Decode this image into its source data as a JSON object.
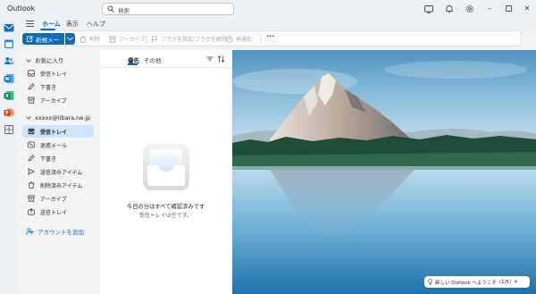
{
  "app": {
    "title": "Outlook"
  },
  "search": {
    "placeholder": "検索"
  },
  "ribbon": {
    "tabs": [
      {
        "label": "ホーム",
        "active": true
      },
      {
        "label": "表示",
        "active": false
      },
      {
        "label": "ヘルプ",
        "active": false
      }
    ],
    "new_mail_label": "新規メール",
    "buttons": {
      "delete": "削除",
      "archive": "アーカイブ",
      "flag": "フラグを設定/フラグを解除",
      "snooze": "再通知",
      "more": "···"
    }
  },
  "folders": {
    "favorites_header": "お気に入り",
    "favorites": [
      {
        "label": "受信トレイ",
        "icon": "inbox-icon"
      },
      {
        "label": "下書き",
        "icon": "draft-icon"
      },
      {
        "label": "アーカイブ",
        "icon": "archive-icon"
      }
    ],
    "account_header": "xxxxx@libara.ne.jp",
    "account_folders": [
      {
        "label": "受信トレイ",
        "icon": "inbox-icon",
        "selected": true
      },
      {
        "label": "迷惑メール",
        "icon": "junk-icon"
      },
      {
        "label": "下書き",
        "icon": "draft-icon"
      },
      {
        "label": "送信済みアイテム",
        "icon": "sent-icon"
      },
      {
        "label": "削除済みアイテム",
        "icon": "trash-icon"
      },
      {
        "label": "アーカイブ",
        "icon": "archive-icon"
      },
      {
        "label": "送信トレイ",
        "icon": "outbox-icon"
      }
    ],
    "add_account_label": "アカウントを追加"
  },
  "message_list": {
    "tabs": [
      {
        "label": "優先",
        "active": true
      },
      {
        "label": "その他",
        "active": false
      }
    ],
    "empty_title": "今日の分はすべて確認済みです",
    "empty_subtitle": "受信トレイは空です。"
  },
  "reading_pane": {
    "welcome_text": "新しい Outlook へようこそ",
    "welcome_pager": "(1/5)"
  },
  "colors": {
    "accent": "#0f6cbd",
    "selected_folder": "#cfe4fa",
    "chrome": "#edf1f6"
  }
}
